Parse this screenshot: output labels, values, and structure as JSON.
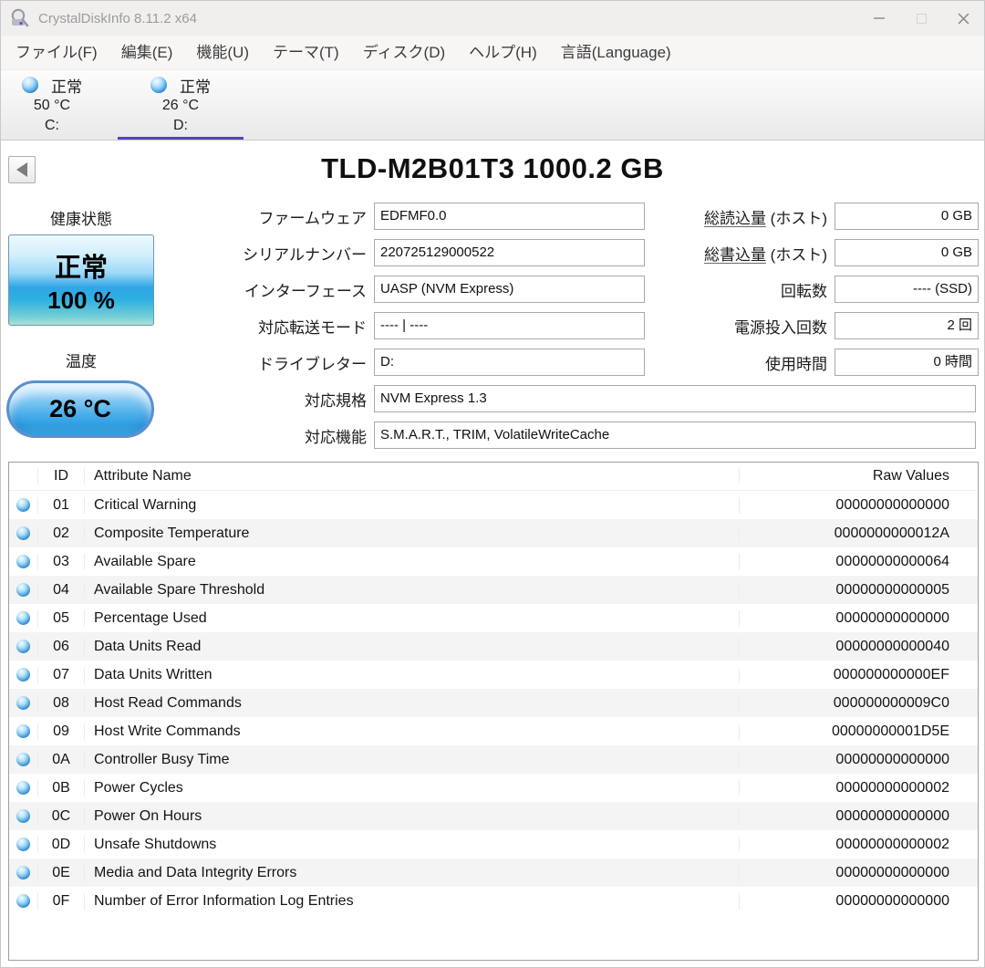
{
  "window": {
    "title": "CrystalDiskInfo 8.11.2 x64",
    "app_icon": "disk-magnifier-icon",
    "controls": {
      "minimize": "minimize-icon",
      "maximize": "maximize-icon",
      "close": "close-icon"
    }
  },
  "menu": {
    "items": [
      {
        "label": "ファイル(F)"
      },
      {
        "label": "編集(E)"
      },
      {
        "label": "機能(U)"
      },
      {
        "label": "テーマ(T)"
      },
      {
        "label": "ディスク(D)"
      },
      {
        "label": "ヘルプ(H)"
      },
      {
        "label": "言語(Language)"
      }
    ]
  },
  "drive_tabs": [
    {
      "status": "正常",
      "temp": "50 °C",
      "letter": "C:",
      "selected": false
    },
    {
      "status": "正常",
      "temp": "26 °C",
      "letter": "D:",
      "selected": true
    }
  ],
  "drive": {
    "title": "TLD-M2B01T3 1000.2 GB",
    "health": {
      "label": "健康状態",
      "status": "正常",
      "percent": "100 %"
    },
    "temperature": {
      "label": "温度",
      "value": "26 °C"
    },
    "fields_mid": [
      {
        "label": "ファームウェア",
        "value": "EDFMF0.0",
        "wide": false
      },
      {
        "label": "シリアルナンバー",
        "value": "220725129000522",
        "wide": false
      },
      {
        "label": "インターフェース",
        "value": "UASP (NVM Express)",
        "wide": false
      },
      {
        "label": "対応転送モード",
        "value": "---- | ----",
        "wide": false
      },
      {
        "label": "ドライブレター",
        "value": "D:",
        "wide": false
      },
      {
        "label": "対応規格",
        "value": "NVM Express 1.3",
        "wide": true
      },
      {
        "label": "対応機能",
        "value": "S.M.A.R.T., TRIM, VolatileWriteCache",
        "wide": true
      }
    ],
    "fields_right": [
      {
        "label": "総読込量",
        "suffix": " (ホスト)",
        "value": "0 GB",
        "underline": true
      },
      {
        "label": "総書込量",
        "suffix": " (ホスト)",
        "value": "0 GB",
        "underline": true
      },
      {
        "label": "回転数",
        "suffix": "",
        "value": "---- (SSD)",
        "underline": false
      },
      {
        "label": "電源投入回数",
        "suffix": "",
        "value": "2 回",
        "underline": false
      },
      {
        "label": "使用時間",
        "suffix": "",
        "value": "0 時間",
        "underline": false
      }
    ]
  },
  "smart": {
    "headers": {
      "id": "ID",
      "name": "Attribute Name",
      "raw": "Raw Values"
    },
    "status_icon": "blue-health-orb",
    "rows": [
      {
        "id": "01",
        "name": "Critical Warning",
        "raw": "00000000000000"
      },
      {
        "id": "02",
        "name": "Composite Temperature",
        "raw": "0000000000012A"
      },
      {
        "id": "03",
        "name": "Available Spare",
        "raw": "00000000000064"
      },
      {
        "id": "04",
        "name": "Available Spare Threshold",
        "raw": "00000000000005"
      },
      {
        "id": "05",
        "name": "Percentage Used",
        "raw": "00000000000000"
      },
      {
        "id": "06",
        "name": "Data Units Read",
        "raw": "00000000000040"
      },
      {
        "id": "07",
        "name": "Data Units Written",
        "raw": "000000000000EF"
      },
      {
        "id": "08",
        "name": "Host Read Commands",
        "raw": "000000000009C0"
      },
      {
        "id": "09",
        "name": "Host Write Commands",
        "raw": "00000000001D5E"
      },
      {
        "id": "0A",
        "name": "Controller Busy Time",
        "raw": "00000000000000"
      },
      {
        "id": "0B",
        "name": "Power Cycles",
        "raw": "00000000000002"
      },
      {
        "id": "0C",
        "name": "Power On Hours",
        "raw": "00000000000000"
      },
      {
        "id": "0D",
        "name": "Unsafe Shutdowns",
        "raw": "00000000000002"
      },
      {
        "id": "0E",
        "name": "Media and Data Integrity Errors",
        "raw": "00000000000000"
      },
      {
        "id": "0F",
        "name": "Number of Error Information Log Entries",
        "raw": "00000000000000"
      }
    ]
  },
  "colors": {
    "selected_tab_underline": "#5444c4",
    "orb_blue": "#2f8ed8",
    "health_badge_blue": "#30a5e6",
    "titlebar_bg": "#f1efee"
  }
}
